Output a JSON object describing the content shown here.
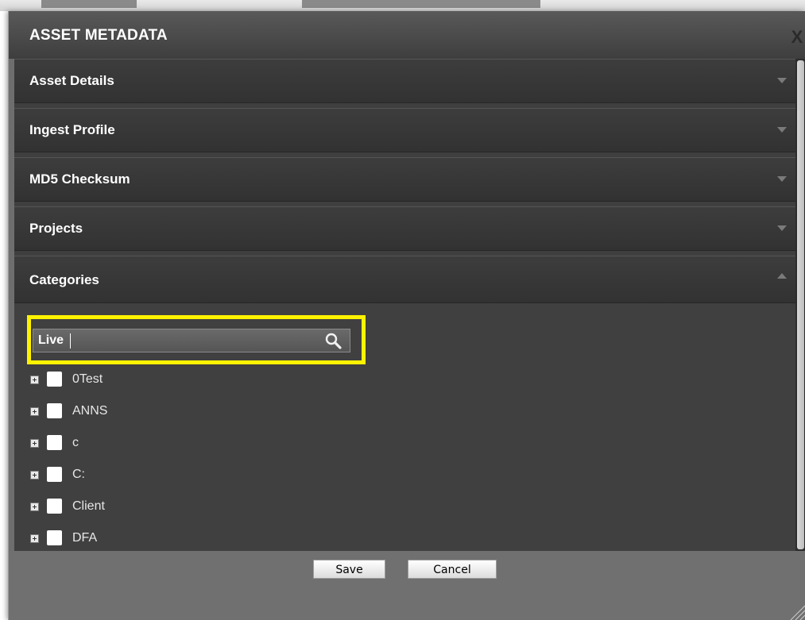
{
  "dialog": {
    "title": "ASSET METADATA",
    "close_label": "X"
  },
  "sections": [
    {
      "label": "Asset Details",
      "state": "collapsed"
    },
    {
      "label": "Ingest Profile",
      "state": "collapsed"
    },
    {
      "label": "MD5 Checksum",
      "state": "collapsed"
    },
    {
      "label": "Projects",
      "state": "collapsed"
    },
    {
      "label": "Categories",
      "state": "expanded"
    }
  ],
  "categories": {
    "search_value": "Live",
    "search_icon": "magnifier-icon",
    "items": [
      {
        "label": "0Test",
        "checked": false
      },
      {
        "label": "ANNS",
        "checked": false
      },
      {
        "label": "c",
        "checked": false
      },
      {
        "label": "C:",
        "checked": false
      },
      {
        "label": "Client",
        "checked": false
      },
      {
        "label": "DFA",
        "checked": false
      }
    ]
  },
  "footer": {
    "save_label": "Save",
    "cancel_label": "Cancel"
  },
  "colors": {
    "highlight": "#fff200",
    "panel": "#404040",
    "header": "#353535"
  }
}
